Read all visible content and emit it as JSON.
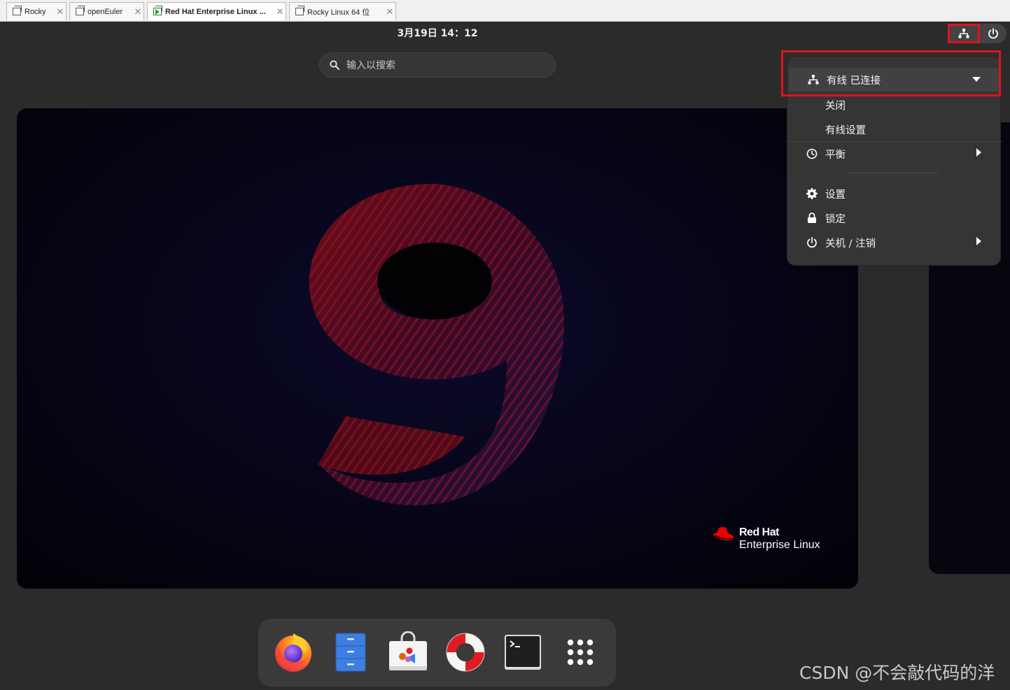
{
  "vm_tabs": [
    {
      "label": "Rocky",
      "active": false
    },
    {
      "label": "openEuler",
      "active": false
    },
    {
      "label": "Red Hat Enterprise Linux ...",
      "active": true
    },
    {
      "label": "Rocky Linux 64 位",
      "active": false
    }
  ],
  "topbar": {
    "clock": "3月19日  14：12",
    "network_icon": "network-wired-icon",
    "power_icon": "power-icon"
  },
  "search": {
    "placeholder": "输入以搜索",
    "icon": "search-icon"
  },
  "workspace": {
    "wallpaper": "rhel-9-wallpaper",
    "logo_brand": "Red Hat",
    "logo_product": "Enterprise Linux"
  },
  "system_menu": {
    "network": {
      "label": "有线 已连接",
      "icon": "network-wired-icon",
      "expanded": true
    },
    "network_off": "关闭",
    "network_settings": "有线设置",
    "power_mode": {
      "label": "平衡",
      "icon": "power-profile-icon"
    },
    "settings": {
      "label": "设置",
      "icon": "gear-icon"
    },
    "lock": {
      "label": "锁定",
      "icon": "lock-icon"
    },
    "shutdown": {
      "label": "关机 / 注销",
      "icon": "power-icon"
    }
  },
  "dock": [
    {
      "name": "Firefox",
      "icon": "firefox-icon"
    },
    {
      "name": "Files",
      "icon": "files-icon"
    },
    {
      "name": "Software",
      "icon": "software-icon"
    },
    {
      "name": "Help",
      "icon": "help-icon"
    },
    {
      "name": "Terminal",
      "icon": "terminal-icon"
    },
    {
      "name": "Show Applications",
      "icon": "app-grid-icon"
    }
  ],
  "watermark": "CSDN @不会敲代码的洋",
  "colors": {
    "highlight": "#e0121f",
    "menu_bg": "#353535",
    "desktop_bg": "#2b2b2b",
    "redhat_red": "#ee0000"
  }
}
